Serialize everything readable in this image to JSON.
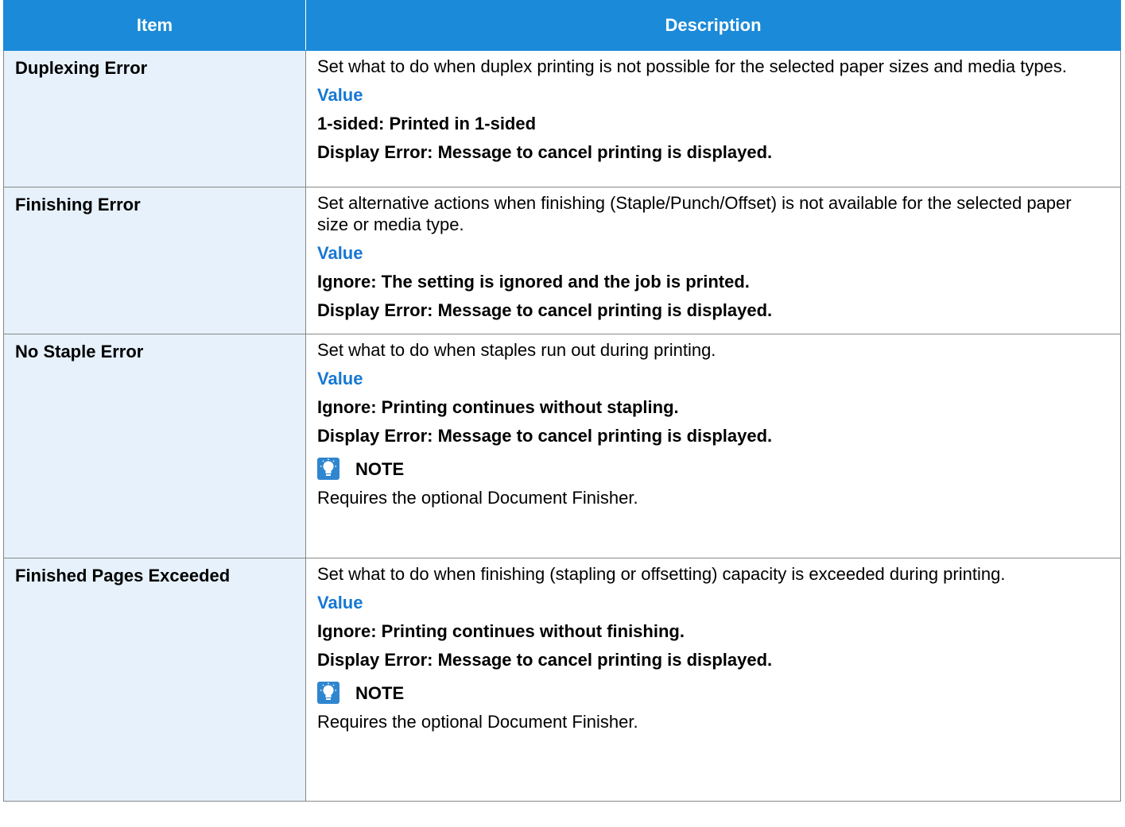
{
  "table": {
    "header_item": "Item",
    "header_description": "Description",
    "value_label": "Value",
    "note_label": "NOTE",
    "rows": [
      {
        "item": "Duplexing Error",
        "description": "Set what to do when duplex printing is not possible for the selected paper sizes and media types.",
        "options": [
          "1-sided: Printed in 1-sided",
          "Display Error: Message to cancel printing is displayed."
        ]
      },
      {
        "item": "Finishing Error",
        "description": "Set alternative actions when finishing (Staple/Punch/Offset) is not available for the selected paper size or media type.",
        "options": [
          "Ignore: The setting is ignored and the job is printed.",
          "Display Error: Message to cancel printing is displayed."
        ]
      },
      {
        "item": "No Staple Error",
        "description": "Set what to do when staples run out during printing.",
        "options": [
          "Ignore: Printing continues without stapling.",
          "Display Error: Message to cancel printing is displayed."
        ],
        "note": "Requires the optional Document Finisher."
      },
      {
        "item": "Finished Pages Exceeded",
        "description": "Set what to do when finishing (stapling or offsetting) capacity is exceeded during printing.",
        "options": [
          "Ignore: Printing continues without finishing.",
          "Display Error: Message to cancel printing is displayed."
        ],
        "note": "Requires the optional Document Finisher."
      }
    ]
  },
  "colors": {
    "header_bg": "#1b8ad8",
    "item_bg": "#e6f1fb",
    "value_label": "#1677d2"
  },
  "icons": {
    "note": "lightbulb-note-icon"
  }
}
